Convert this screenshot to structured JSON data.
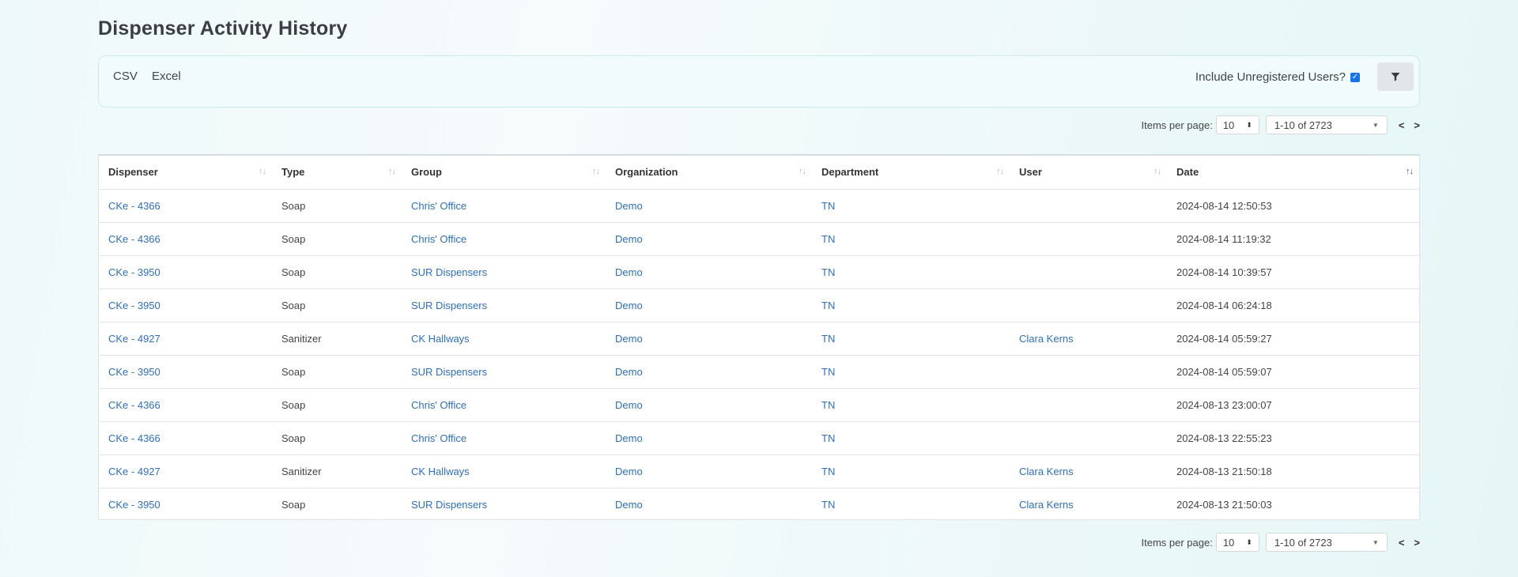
{
  "page": {
    "title": "Dispenser Activity History"
  },
  "toolbar": {
    "csv_label": "CSV",
    "excel_label": "Excel",
    "include_unregistered_label": "Include Unregistered Users?",
    "include_unregistered_checked": true
  },
  "pagination": {
    "items_per_page_label": "Items per page:",
    "items_per_page_value": "10",
    "range_text": "1-10 of 2723"
  },
  "table": {
    "headers": [
      "Dispenser",
      "Type",
      "Group",
      "Organization",
      "Department",
      "User",
      "Date"
    ],
    "rows": [
      [
        "CKe - 4366",
        "Soap",
        "Chris' Office",
        "Demo",
        "TN",
        "",
        "2024-08-14 12:50:53"
      ],
      [
        "CKe - 4366",
        "Soap",
        "Chris' Office",
        "Demo",
        "TN",
        "",
        "2024-08-14 11:19:32"
      ],
      [
        "CKe - 3950",
        "Soap",
        "SUR Dispensers",
        "Demo",
        "TN",
        "",
        "2024-08-14 10:39:57"
      ],
      [
        "CKe - 3950",
        "Soap",
        "SUR Dispensers",
        "Demo",
        "TN",
        "",
        "2024-08-14 06:24:18"
      ],
      [
        "CKe - 4927",
        "Sanitizer",
        "CK Hallways",
        "Demo",
        "TN",
        "Clara Kerns",
        "2024-08-14 05:59:27"
      ],
      [
        "CKe - 3950",
        "Soap",
        "SUR Dispensers",
        "Demo",
        "TN",
        "",
        "2024-08-14 05:59:07"
      ],
      [
        "CKe - 4366",
        "Soap",
        "Chris' Office",
        "Demo",
        "TN",
        "",
        "2024-08-13 23:00:07"
      ],
      [
        "CKe - 4366",
        "Soap",
        "Chris' Office",
        "Demo",
        "TN",
        "",
        "2024-08-13 22:55:23"
      ],
      [
        "CKe - 4927",
        "Sanitizer",
        "CK Hallways",
        "Demo",
        "TN",
        "Clara Kerns",
        "2024-08-13 21:50:18"
      ],
      [
        "CKe - 3950",
        "Soap",
        "SUR Dispensers",
        "Demo",
        "TN",
        "Clara Kerns",
        "2024-08-13 21:50:03"
      ]
    ]
  },
  "colors": {
    "link": "#2f6fb7",
    "checkbox": "#1a73e8"
  }
}
